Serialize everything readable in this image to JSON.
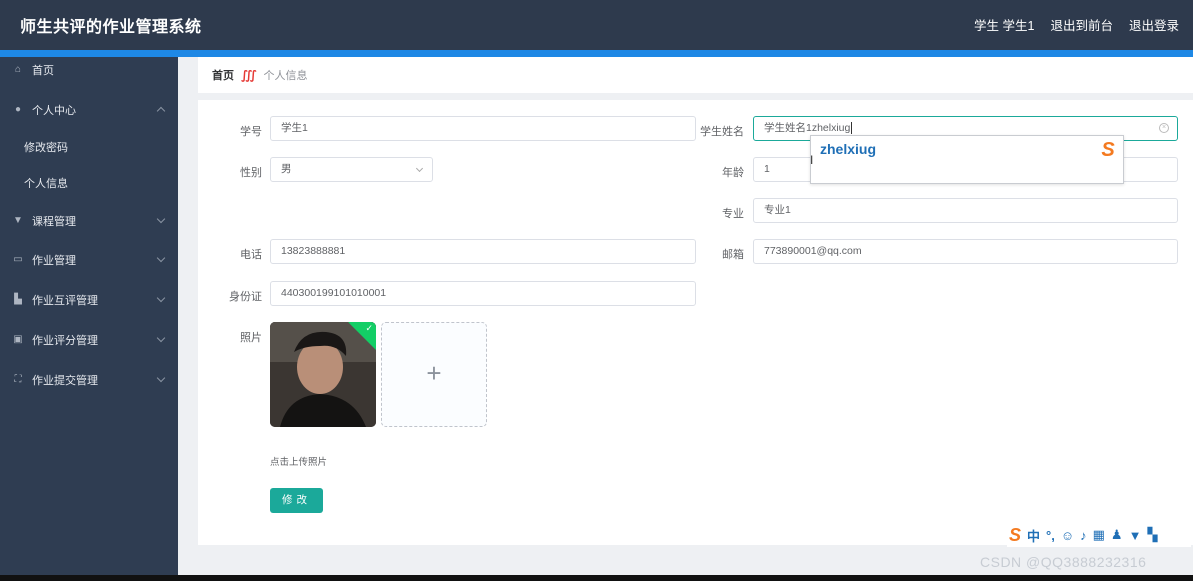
{
  "header": {
    "app_title": "师生共评的作业管理系统",
    "user_label": "学生 学生1",
    "to_front_label": "退出到前台",
    "logout_label": "退出登录"
  },
  "sidebar": {
    "home": "首页",
    "personal_center": "个人中心",
    "change_password": "修改密码",
    "personal_info": "个人信息",
    "course_mgmt": "课程管理",
    "homework_mgmt": "作业管理",
    "peer_review_mgmt": "作业互评管理",
    "grading_mgmt": "作业评分管理",
    "submission_mgmt": "作业提交管理"
  },
  "breadcrumb": {
    "home": "首页",
    "current": "个人信息"
  },
  "form": {
    "student_id_label": "学号",
    "student_id_value": "学生1",
    "student_name_label": "学生姓名",
    "student_name_value": "学生姓名1zhelxiug",
    "gender_label": "性别",
    "gender_value": "男",
    "age_label": "年龄",
    "age_value": "1",
    "major_label": "专业",
    "major_value": "专业1",
    "phone_label": "电话",
    "phone_value": "13823888881",
    "email_label": "邮箱",
    "email_value": "773890001@qq.com",
    "id_card_label": "身份证",
    "id_card_value": "440300199101010001",
    "photo_label": "照片",
    "upload_tip": "点击上传照片",
    "submit_label": "修改"
  },
  "ime_popup": {
    "candidate": "zhelxiug"
  },
  "ime_toolbar": {
    "mode": "中"
  },
  "watermark": "CSDN @QQ3888232316"
}
